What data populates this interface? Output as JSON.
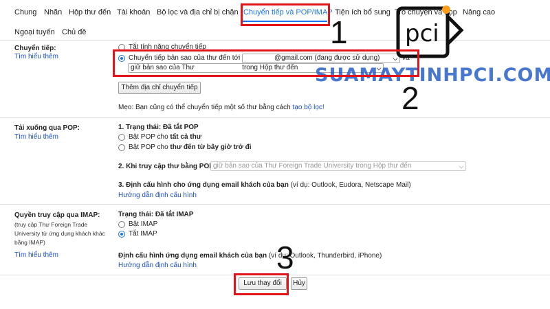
{
  "tabs": [
    {
      "label": "Chung"
    },
    {
      "label": "Nhãn"
    },
    {
      "label": "Hộp thư đến"
    },
    {
      "label": "Tài khoản"
    },
    {
      "label": "Bộ lọc và địa chỉ bị chặn"
    },
    {
      "label": "Chuyển tiếp và POP/IMAP",
      "active": true
    },
    {
      "label": "Tiện ích bổ sung"
    },
    {
      "label": "Trò chuyện và họp"
    },
    {
      "label": "Nâng cao"
    },
    {
      "label": "Ngoại tuyến"
    },
    {
      "label": "Chủ đề"
    }
  ],
  "forwarding": {
    "label": "Chuyển tiếp:",
    "learn_more": "Tìm hiểu thêm",
    "option_off": "Tắt tính năng chuyển tiếp",
    "option_on": "Chuyển tiếp bản sao của thư đến tới",
    "email_select": "@gmail.com (đang được sử dụng)",
    "and": "và",
    "action_select": "giữ bản sao của Thư                         trong Hộp thư đến",
    "add_button": "Thêm địa chỉ chuyển tiếp",
    "tip_prefix": "Mẹo: Bạn cũng có thể chuyển tiếp một số thư bằng cách ",
    "tip_link": "tạo bộ lọc!"
  },
  "pop": {
    "label": "Tải xuống qua POP:",
    "learn_more": "Tìm hiểu thêm",
    "status": "1. Trạng thái: Đã tắt POP",
    "opt_all_prefix": "Bật POP cho ",
    "opt_all_bold": "tất cả thư",
    "opt_now_prefix": "Bật POP cho ",
    "opt_now_bold": "thư đến từ bây giờ trở đi",
    "step2": "2. Khi truy cập thư bằng POP",
    "step2_select": "giữ bản sao của Thư Foreign Trade University trong Hộp thư đến",
    "step3_bold": "3. Định cấu hình cho ứng dụng email khách của bạn",
    "step3_rest": " (ví dụ: Outlook, Eudora, Netscape Mail)",
    "config_link": "Hướng dẫn định cấu hình"
  },
  "imap": {
    "label": "Quyền truy cập qua IMAP:",
    "note_lines": [
      "(truy cập Thư Foreign Trade",
      "University từ ứng dụng khách khác",
      "bằng IMAP)"
    ],
    "learn_more": "Tìm hiểu thêm",
    "status": "Trạng thái: Đã tắt IMAP",
    "opt_on": "Bật IMAP",
    "opt_off": "Tắt IMAP",
    "config_bold": "Định cấu hình ứng dụng email khách của bạn",
    "config_rest": " (ví dụ: Outlook, Thunderbird, iPhone)",
    "config_link": "Hướng dẫn định cấu hình"
  },
  "footer": {
    "save": "Lưu thay đổi",
    "cancel": "Hủy"
  },
  "annotations": {
    "n1": "1",
    "n2": "2",
    "n3": "3"
  },
  "watermark": {
    "text": "SUAMAYTINHPCI.COM",
    "logo_text": "pci"
  },
  "colors": {
    "accent": "#1a73e8",
    "link": "#1a4dc8",
    "highlight": "#e2121b"
  }
}
